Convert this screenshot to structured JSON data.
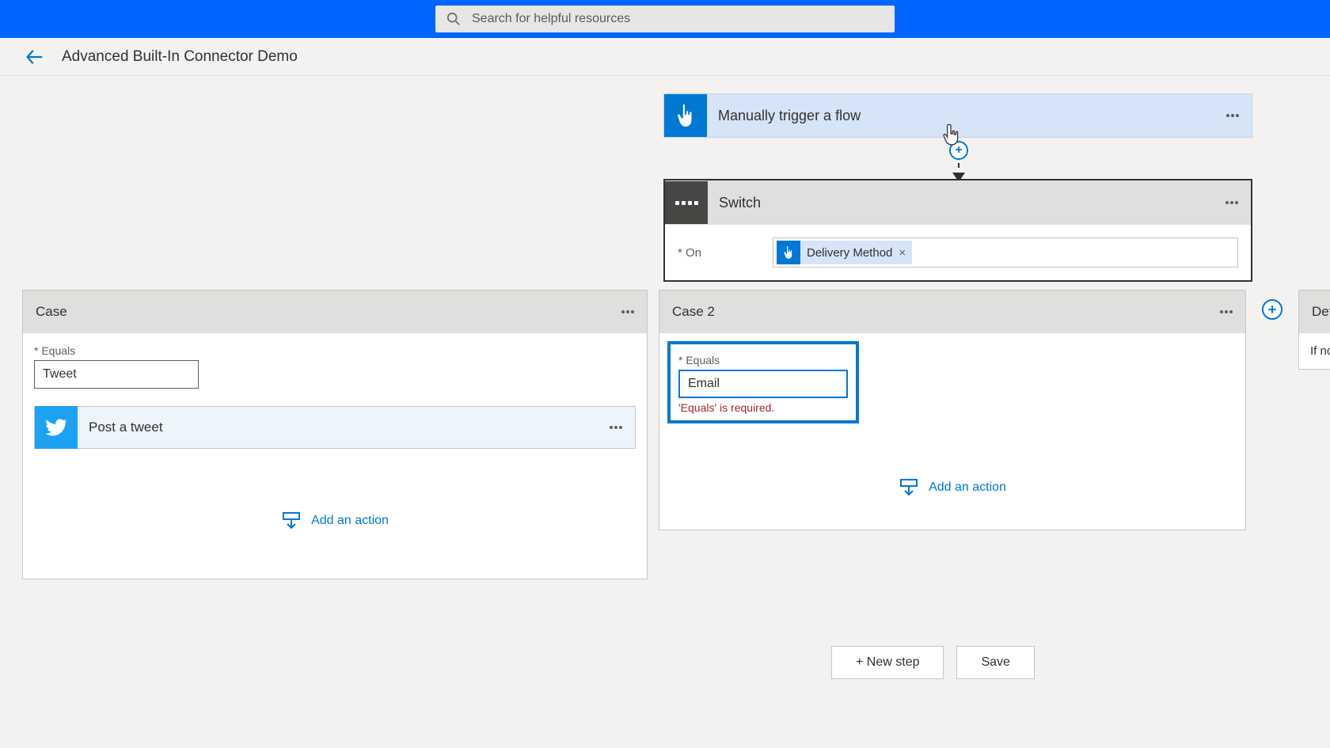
{
  "search": {
    "placeholder": "Search for helpful resources"
  },
  "breadcrumb": {
    "title": "Advanced Built-In Connector Demo"
  },
  "trigger": {
    "title": "Manually trigger a flow"
  },
  "switch": {
    "title": "Switch",
    "on_label": "On",
    "token_text": "Delivery Method"
  },
  "case1": {
    "title": "Case",
    "equals_label": "Equals",
    "equals_value": "Tweet",
    "action_title": "Post a tweet",
    "add_action": "Add an action"
  },
  "case2": {
    "title": "Case 2",
    "equals_label": "Equals",
    "equals_value": "Email",
    "error": "'Equals' is required.",
    "add_action": "Add an action"
  },
  "default_card": {
    "title": "Default",
    "body": "If no"
  },
  "footer": {
    "new_step": "+ New step",
    "save": "Save"
  }
}
